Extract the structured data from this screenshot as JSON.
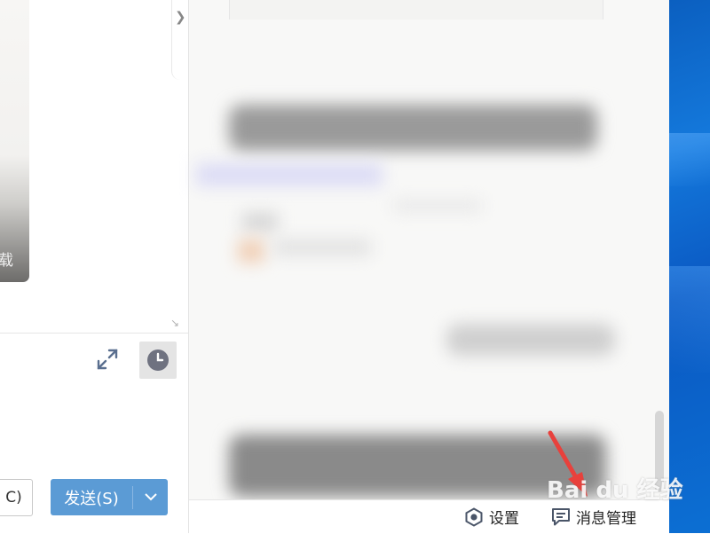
{
  "left_panel": {
    "message_card_text": "载",
    "close_button_label": "C)",
    "send_button_label": "发送(S)"
  },
  "bottom_bar": {
    "settings_label": "设置",
    "message_manager_label": "消息管理"
  },
  "watermark": {
    "text": "Bai  du 经验"
  },
  "icons": {
    "collapse": "chevron-right-icon",
    "resize": "resize-icon",
    "expand": "expand-icon",
    "history": "clock-icon",
    "send_dropdown": "chevron-down-icon",
    "settings": "hexagon-gear-icon",
    "message_manager": "message-icon"
  },
  "colors": {
    "send_button": "#5b9bd5",
    "desktop": "#0b5fc0",
    "annotation_arrow": "#e8413c"
  }
}
